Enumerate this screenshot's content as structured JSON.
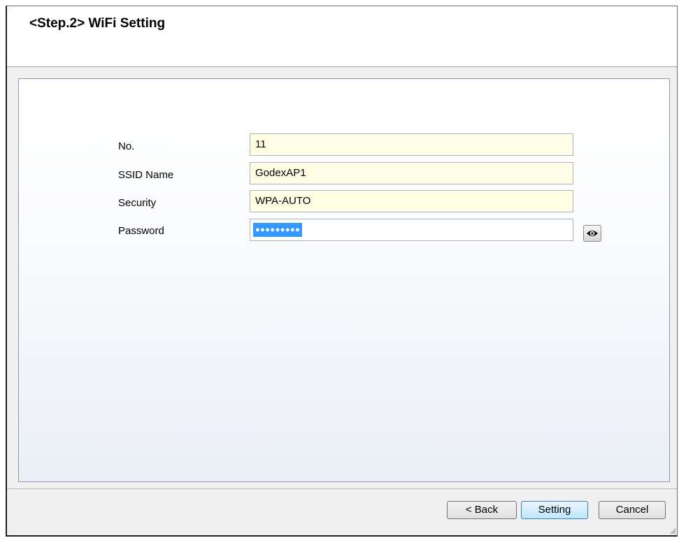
{
  "header": {
    "title": "<Step.2> WiFi Setting"
  },
  "form": {
    "fields": [
      {
        "label": "No.",
        "value": "11"
      },
      {
        "label": "SSID Name",
        "value": "GodexAP1"
      },
      {
        "label": "Security",
        "value": "WPA-AUTO"
      },
      {
        "label": "Password",
        "value": "●●●●●●●●●",
        "selected": true
      }
    ],
    "show_password_icon": "eye-icon"
  },
  "footer": {
    "back_label": "< Back",
    "setting_label": "Setting",
    "cancel_label": "Cancel"
  },
  "colors": {
    "field_background": "#fffde3",
    "selection": "#3399ff",
    "default_button": "#bee6fd"
  }
}
